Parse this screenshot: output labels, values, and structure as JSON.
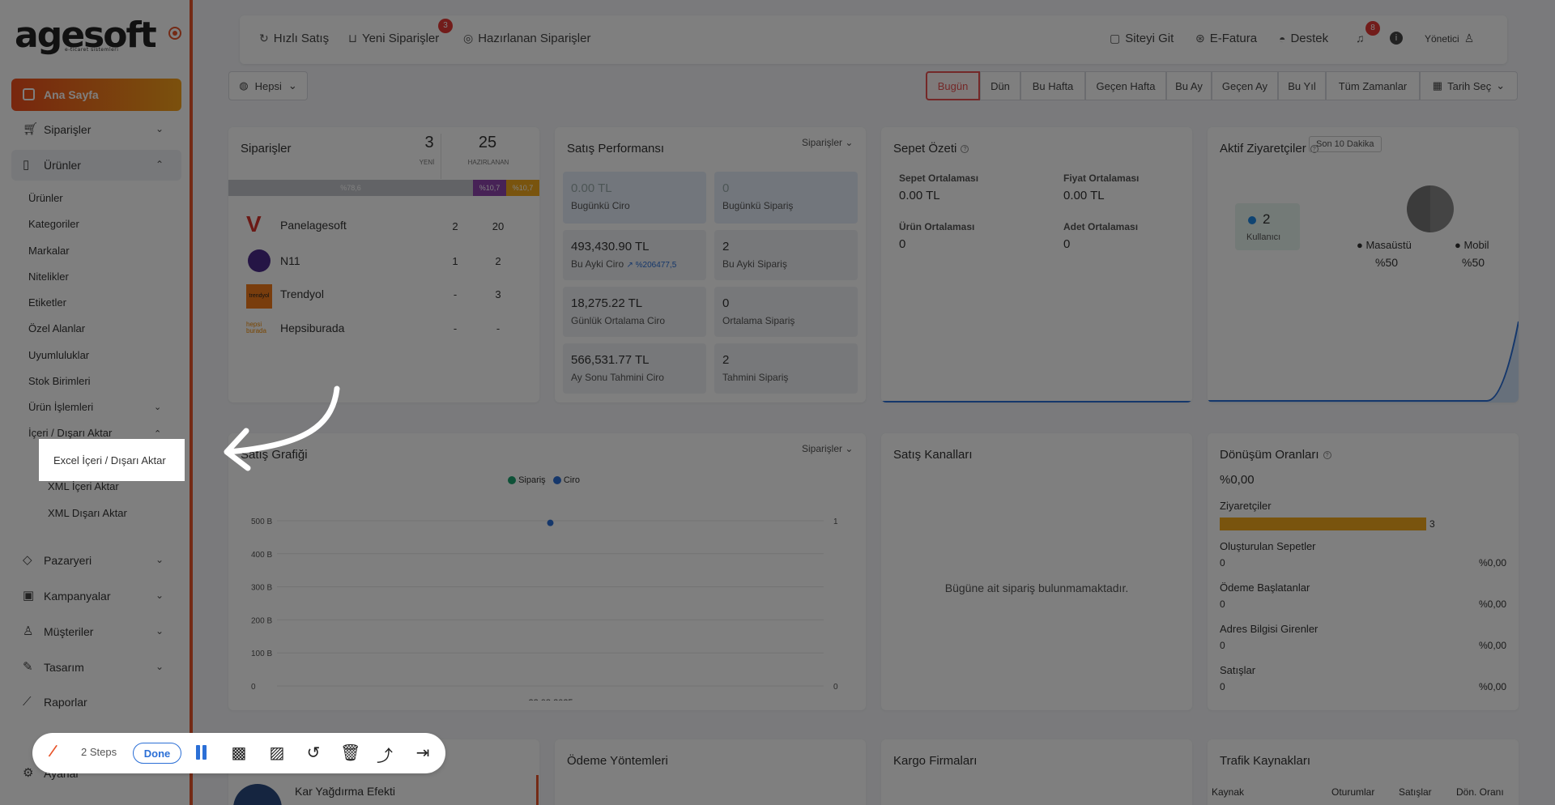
{
  "sidebar": {
    "logo": "agesoft",
    "logo_sub": "e-ticaret sistemleri",
    "home": "Ana Sayfa",
    "items": [
      {
        "label": "Siparişler",
        "icon": "cart-icon"
      },
      {
        "label": "Ürünler",
        "icon": "book-icon"
      }
    ],
    "urunler_sub": [
      "Ürünler",
      "Kategoriler",
      "Markalar",
      "Nitelikler",
      "Etiketler",
      "Özel Alanlar",
      "Uyumluluklar",
      "Stok Birimleri",
      "Ürün İşlemleri",
      "İçeri / Dışarı Aktar"
    ],
    "aktar_sub": [
      "Excel İçeri / Dışarı Aktar",
      "XML İçeri Aktar",
      "XML Dışarı Aktar"
    ],
    "bottom_items": [
      {
        "label": "Pazaryeri"
      },
      {
        "label": "Kampanyalar"
      },
      {
        "label": "Müşteriler"
      },
      {
        "label": "Tasarım"
      },
      {
        "label": "Raporlar"
      },
      {
        "label": "Ayarlar"
      }
    ]
  },
  "topbar": {
    "hizli_satis": "Hızlı Satış",
    "yeni_siparisler": "Yeni Siparişler",
    "yeni_siparisler_badge": "3",
    "hazirlanan": "Hazırlanan Siparişler",
    "siteyi_git": "Siteyi Git",
    "efatura": "E-Fatura",
    "destek": "Destek",
    "notif_badge": "8",
    "user": "Yönetici"
  },
  "filters": {
    "store": "Hepsi",
    "ranges": [
      "Bugün",
      "Dün",
      "Bu Hafta",
      "Geçen Hafta",
      "Bu Ay",
      "Geçen Ay",
      "Bu Yıl",
      "Tüm Zamanlar"
    ],
    "date_pick": "Tarih Seç"
  },
  "orders": {
    "title": "Siparişler",
    "new_count": "3",
    "new_label": "YENİ",
    "prep_count": "25",
    "prep_label": "HAZIRLANAN",
    "bar_gray": "%78,6",
    "bar_purple": "%10,7",
    "bar_orange": "%10,7",
    "rows": [
      {
        "name": "Panelagesoft",
        "a": "2",
        "b": "20"
      },
      {
        "name": "N11",
        "a": "1",
        "b": "2"
      },
      {
        "name": "Trendyol",
        "a": "-",
        "b": "3"
      },
      {
        "name": "Hepsiburada",
        "a": "-",
        "b": "-"
      }
    ],
    "trendyol_logo": "trendyol",
    "hb_logo1": "hepsi",
    "hb_logo2": "burada"
  },
  "performance": {
    "title": "Satış Performansı",
    "dropdown": "Siparişler",
    "tiles": [
      {
        "v": "0.00 TL",
        "l": "Bugünkü Ciro"
      },
      {
        "v": "0",
        "l": "Bugünkü Sipariş"
      },
      {
        "v": "493,430.90 TL",
        "l": "Bu Ayki Ciro"
      },
      {
        "v": "2",
        "l": "Bu Ayki Sipariş"
      },
      {
        "v": "18,275.22 TL",
        "l": "Günlük Ortalama Ciro"
      },
      {
        "v": "0",
        "l": "Ortalama Sipariş"
      },
      {
        "v": "566,531.77 TL",
        "l": "Ay Sonu Tahmini Ciro"
      },
      {
        "v": "2",
        "l": "Tahmini Sipariş"
      }
    ],
    "growth": "%206477,5"
  },
  "basket": {
    "title": "Sepet Özeti",
    "sepet_ort_l": "Sepet Ortalaması",
    "sepet_ort_v": "0.00 TL",
    "fiyat_ort_l": "Fiyat Ortalaması",
    "fiyat_ort_v": "0.00 TL",
    "urun_ort_l": "Ürün Ortalaması",
    "urun_ort_v": "0",
    "adet_ort_l": "Adet Ortalaması",
    "adet_ort_v": "0"
  },
  "visitors": {
    "title": "Aktif Ziyaretçiler",
    "tag": "Son 10 Dakika",
    "count": "2",
    "count_label": "Kullanıcı",
    "desktop": "Masaüstü",
    "desktop_pct": "%50",
    "mobile": "Mobil",
    "mobile_pct": "%50"
  },
  "sales_chart": {
    "title": "Satış Grafiği",
    "dropdown": "Siparişler",
    "legend_siparis": "Sipariş",
    "legend_ciro": "Ciro",
    "y_ticks": [
      "500 B",
      "400 B",
      "300 B",
      "200 B",
      "100 B",
      "0"
    ],
    "right_ticks": [
      "1",
      "0"
    ],
    "x_label": "22.08.2025"
  },
  "chart_data": {
    "type": "line",
    "categories": [
      "22.08.2025"
    ],
    "series": [
      {
        "name": "Sipariş",
        "values": [
          1
        ]
      },
      {
        "name": "Ciro",
        "values": [
          493430.9
        ]
      }
    ],
    "ylim": [
      0,
      500000
    ],
    "y2lim": [
      0,
      1
    ]
  },
  "channels": {
    "title": "Satış Kanalları",
    "empty": "Bügüne ait sipariş bulunmamaktadır."
  },
  "conversion": {
    "title": "Dönüşüm Oranları",
    "rate": "%0,00",
    "ziyaretciler": "Ziyaretçiler",
    "ziyaretciler_v": "3",
    "ziyaretciler_fill": 1.0,
    "rows": [
      {
        "label": "Oluşturulan Sepetler",
        "v": "0",
        "p": "%0,00"
      },
      {
        "label": "Ödeme Başlatanlar",
        "v": "0",
        "p": "%0,00"
      },
      {
        "label": "Adres Bilgisi Girenler",
        "v": "0",
        "p": "%0,00"
      },
      {
        "label": "Satışlar",
        "v": "0",
        "p": "%0,00"
      }
    ]
  },
  "bottom_cards": {
    "kar": "Kar Yağdırma Efekti",
    "odeme": "Ödeme Yöntemleri",
    "kargo": "Kargo Firmaları",
    "trafik": "Trafik Kaynakları",
    "trafik_cols": [
      "Kaynak",
      "Oturumlar",
      "Satışlar",
      "Dön. Oranı"
    ]
  },
  "stepbar": {
    "steps": "2 Steps",
    "done": "Done"
  },
  "colors": {
    "accent": "#e8542a",
    "blue": "#2b6fd6",
    "green": "#1aa36f",
    "bar_orange": "#f2a91d",
    "bar_purple": "#8e44ad"
  }
}
